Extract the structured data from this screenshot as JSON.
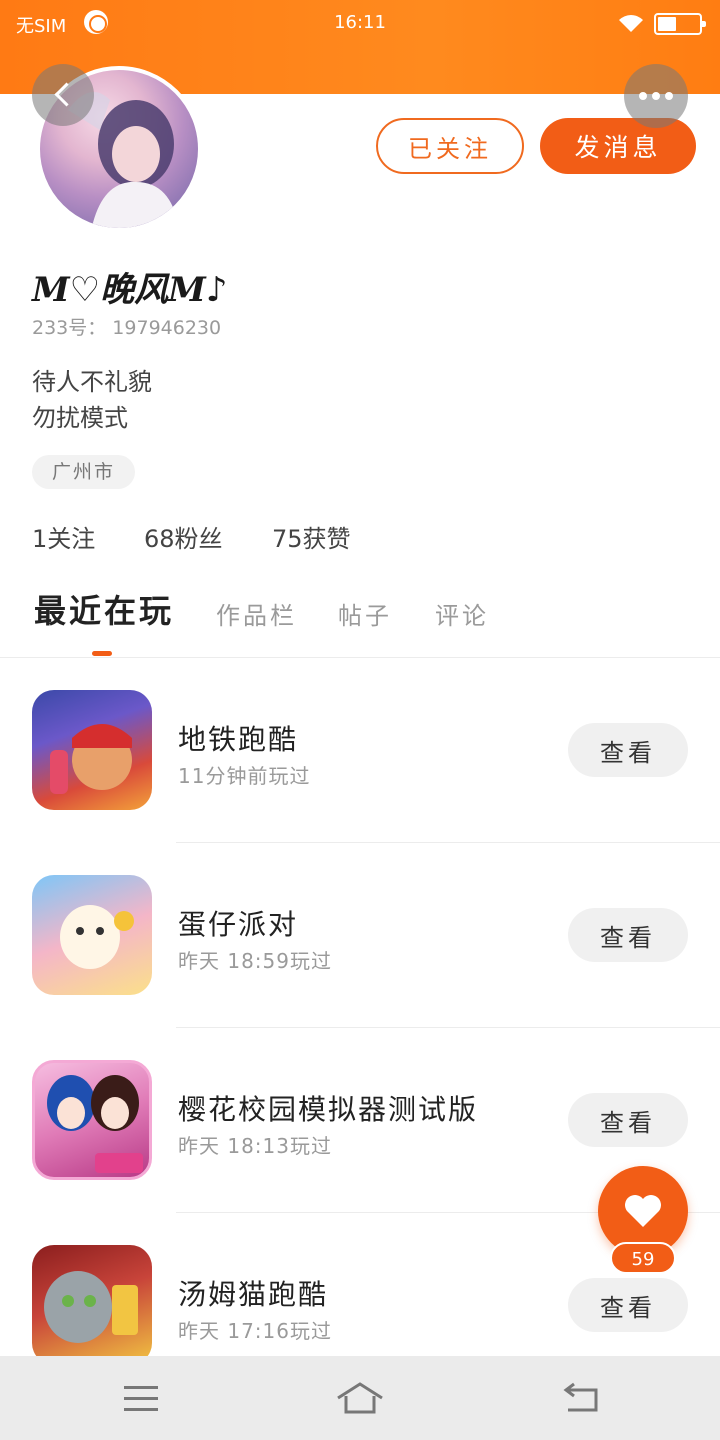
{
  "status_bar": {
    "carrier": "无SIM",
    "time": "16:11"
  },
  "profile": {
    "nickname": "M♡晚风M♪",
    "uid": "233号： 197946230",
    "bio_line1": "待人不礼貌",
    "bio_line2": "勿扰模式",
    "location": "广州市",
    "followed_label": "已关注",
    "message_label": "发消息"
  },
  "stats": {
    "following": "1关注",
    "fans": "68粉丝",
    "likes": "75获赞"
  },
  "tabs": [
    {
      "label": "最近在玩"
    },
    {
      "label": "作品栏"
    },
    {
      "label": "帖子"
    },
    {
      "label": "评论"
    }
  ],
  "games": [
    {
      "name": "地铁跑酷",
      "played": "11分钟前玩过",
      "button": "查看"
    },
    {
      "name": "蛋仔派对",
      "played": "昨天 18:59玩过",
      "button": "查看"
    },
    {
      "name": "樱花校园模拟器测试版",
      "played": "昨天 18:13玩过",
      "button": "查看"
    },
    {
      "name": "汤姆猫跑酷",
      "played": "昨天 17:16玩过",
      "button": "查看"
    }
  ],
  "like_fab": {
    "count": "59"
  },
  "icons": {
    "back": "back-arrow-icon",
    "more": "more-dots-icon",
    "like": "heart-icon",
    "wifi": "wifi-icon",
    "battery": "battery-icon"
  },
  "colors": {
    "accent": "#f25d16",
    "status_bar": "#ff7a14"
  }
}
